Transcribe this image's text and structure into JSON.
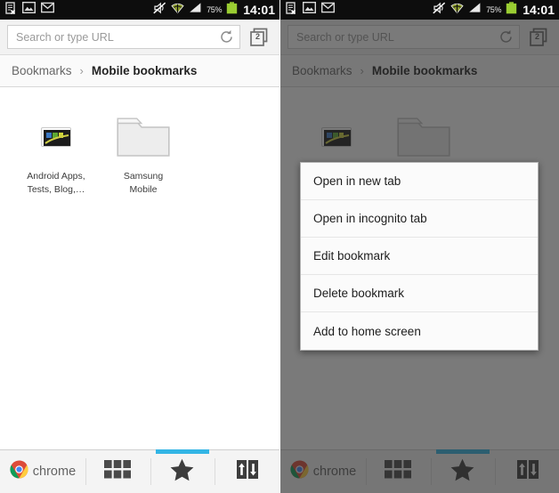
{
  "meta": {
    "app": "Chrome for Android — Bookmarks",
    "panels": [
      "bookmarks-list",
      "bookmarks-list-with-context-menu"
    ]
  },
  "colors": {
    "statusbar_bg": "#0d0d0d",
    "accent_blue": "#33b5e5",
    "battery_green": "#99cc00",
    "dim_overlay": "#666666",
    "menu_bg": "#fbfbfb",
    "chrome_red": "#dd4b39",
    "chrome_yellow": "#ffcd40",
    "chrome_green": "#0f9d58",
    "chrome_blue": "#4285f4"
  },
  "statusbar": {
    "icons_left": [
      "document-cancel-icon",
      "gallery-image-icon",
      "gmail-envelope-icon"
    ],
    "icons_right": [
      "mute-vibrate-off-icon",
      "wifi-icon",
      "cellular-signal-icon"
    ],
    "battery_percent": "75%",
    "battery_icon": "battery-icon",
    "clock": "14:01"
  },
  "omnibox": {
    "placeholder": "Search or type URL",
    "value": "",
    "reload_icon": "reload-icon",
    "tab_switcher_icon": "tab-stack-icon",
    "tab_count": "2"
  },
  "breadcrumb": {
    "root": "Bookmarks",
    "separator": "›",
    "current": "Mobile bookmarks"
  },
  "bookmarks": [
    {
      "type": "site",
      "icon": "site-thumbnail-icon",
      "label_line1": "Android Apps,",
      "label_line2": "Tests, Blog,…"
    },
    {
      "type": "folder",
      "icon": "folder-icon",
      "label_line1": "Samsung",
      "label_line2": "Mobile"
    }
  ],
  "bottom_nav": {
    "items": [
      {
        "id": "chrome",
        "icon": "chrome-logo-icon",
        "label": "chrome",
        "active": false
      },
      {
        "id": "most-visited",
        "icon": "grid-tiles-icon",
        "label": "",
        "active": false
      },
      {
        "id": "bookmarks",
        "icon": "star-icon",
        "label": "",
        "active": true
      },
      {
        "id": "other-devices",
        "icon": "sync-arrows-icon",
        "label": "",
        "active": false
      }
    ]
  },
  "context_menu": {
    "items": [
      "Open in new tab",
      "Open in incognito tab",
      "Edit bookmark",
      "Delete bookmark",
      "Add to home screen"
    ]
  }
}
